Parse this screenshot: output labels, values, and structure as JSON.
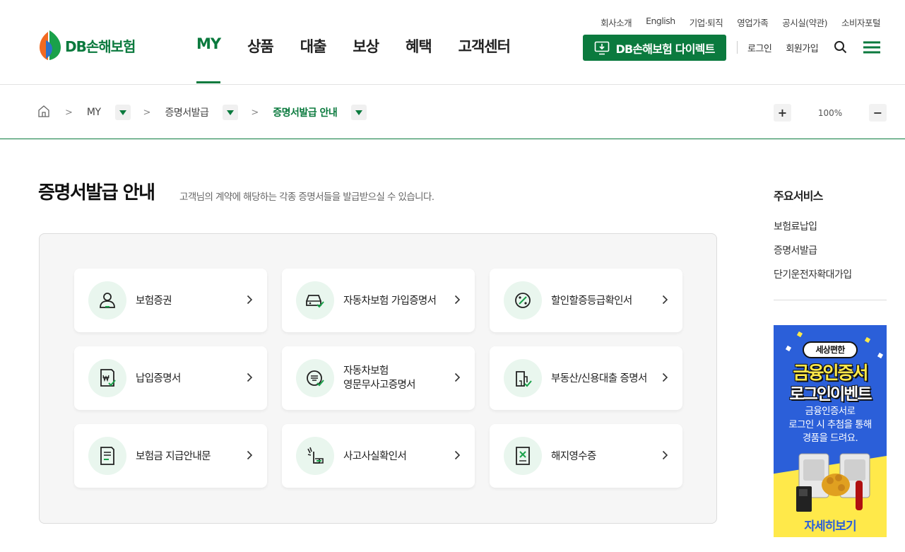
{
  "brand": {
    "name": "DB손해보험",
    "accent": "#0b7a3e"
  },
  "util_links": [
    "회사소개",
    "English",
    "기업·퇴직",
    "영업가족",
    "공시실(약관)",
    "소비자포털"
  ],
  "gnb": [
    {
      "label": "MY",
      "active": true
    },
    {
      "label": "상품"
    },
    {
      "label": "대출"
    },
    {
      "label": "보상"
    },
    {
      "label": "혜택"
    },
    {
      "label": "고객센터"
    }
  ],
  "direct_button": "DB손해보험 다이렉트",
  "auth": {
    "login": "로그인",
    "signup": "회원가입"
  },
  "breadcrumb": [
    "MY",
    "증명서발급",
    "증명서발급 안내"
  ],
  "zoom": {
    "plus": "+",
    "value": "100%",
    "minus": "−"
  },
  "page": {
    "title": "증명서발급 안내",
    "subtitle": "고객님의 계약에 해당하는 각종 증명서들을 발급받으실 수 있습니다."
  },
  "cards": [
    {
      "label": "보험증권",
      "icon": "person-icon"
    },
    {
      "label": "자동차보험 가입증명서",
      "icon": "car-check-icon"
    },
    {
      "label": "할인할증등급확인서",
      "icon": "percent-badge-icon"
    },
    {
      "label": "납입증명서",
      "icon": "won-document-icon"
    },
    {
      "label": "자동차보험\n영문무사고증명서",
      "icon": "no-accident-icon"
    },
    {
      "label": "부동산/신용대출 증명서",
      "icon": "building-check-icon"
    },
    {
      "label": "보험금 지급안내문",
      "icon": "document-list-icon"
    },
    {
      "label": "사고사실확인서",
      "icon": "car-accident-icon"
    },
    {
      "label": "해지영수증",
      "icon": "receipt-x-icon"
    }
  ],
  "side": {
    "title": "주요서비스",
    "links": [
      "보험료납입",
      "증명서발급",
      "단기운전자확대가입"
    ]
  },
  "banner": {
    "pill": "세상편한",
    "headline1": "금융인증서",
    "headline2": "로그인이벤트",
    "desc": "금융인증서로\n로그인 시 추첨을 통해\n경품을 드려요.",
    "cta": "자세히보기"
  }
}
